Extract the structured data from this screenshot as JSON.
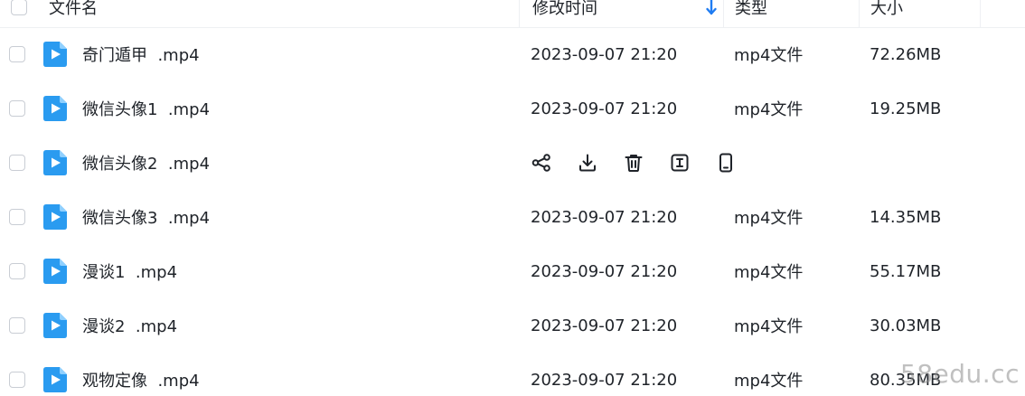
{
  "header": {
    "name_label": "文件名",
    "time_label": "修改时间",
    "type_label": "类型",
    "size_label": "大小",
    "sort_indicator": "arrow-down-icon"
  },
  "files": [
    {
      "name": "奇门遁甲  .mp4",
      "time": "2023-09-07 21:20",
      "type": "mp4文件",
      "size": "72.26MB"
    },
    {
      "name": "微信头像1  .mp4",
      "time": "2023-09-07 21:20",
      "type": "mp4文件",
      "size": "19.25MB"
    },
    {
      "name": "微信头像2  .mp4",
      "time": "",
      "type": "",
      "size": "",
      "hovered": true
    },
    {
      "name": "微信头像3  .mp4",
      "time": "2023-09-07 21:20",
      "type": "mp4文件",
      "size": "14.35MB"
    },
    {
      "name": "漫谈1  .mp4",
      "time": "2023-09-07 21:20",
      "type": "mp4文件",
      "size": "55.17MB"
    },
    {
      "name": "漫谈2  .mp4",
      "time": "2023-09-07 21:20",
      "type": "mp4文件",
      "size": "30.03MB"
    },
    {
      "name": "观物定像  .mp4",
      "time": "2023-09-07 21:20",
      "type": "mp4文件",
      "size": "80.35MB"
    }
  ],
  "row_actions": [
    "share-icon",
    "download-icon",
    "delete-icon",
    "rename-icon",
    "open-on-phone-icon"
  ],
  "colors": {
    "accent": "#1f7cf2",
    "file_icon": "#2a9bf0",
    "text": "#1f2329",
    "border": "#c9cdd4"
  },
  "watermark": "58edu.cc"
}
